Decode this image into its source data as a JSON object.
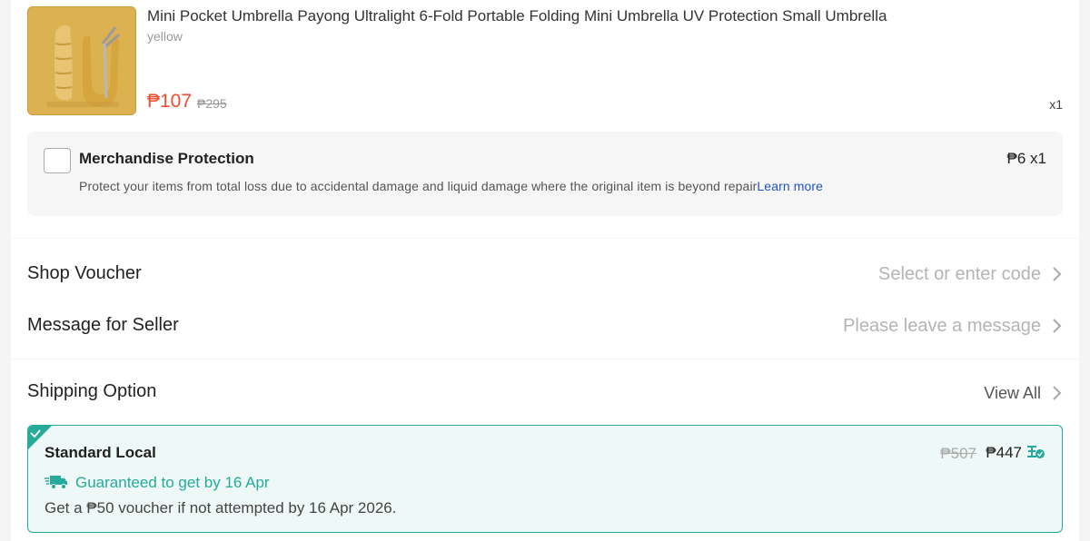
{
  "product": {
    "title": "Mini Pocket Umbrella Payong Ultralight 6-Fold Portable Folding Mini Umbrella UV Protection Small Umbrella",
    "variant": "yellow",
    "price": "₱107",
    "original_price": "₱295",
    "quantity": "x1",
    "image_icon": "umbrella-product-image"
  },
  "protection": {
    "title": "Merchandise Protection",
    "price": "₱6 x1",
    "description": "Protect your items from total loss due to accidental damage and liquid damage where the original item is beyond repair",
    "link": "Learn more",
    "checked": false
  },
  "voucher": {
    "label": "Shop Voucher",
    "placeholder": "Select or enter code"
  },
  "message": {
    "label": "Message for Seller",
    "placeholder": "Please leave a message"
  },
  "shipping": {
    "title": "Shipping Option",
    "view_all": "View All",
    "option": {
      "name": "Standard Local",
      "original_price": "₱507",
      "price": "₱447",
      "guarantee": "Guaranteed to get by 16 Apr",
      "note": "Get a ₱50 voucher if not attempted by 16 Apr 2026.",
      "selected": true
    }
  },
  "colors": {
    "accent_orange": "#ee4d2d",
    "teal": "#26aa99",
    "link_blue": "#1e54c6"
  }
}
